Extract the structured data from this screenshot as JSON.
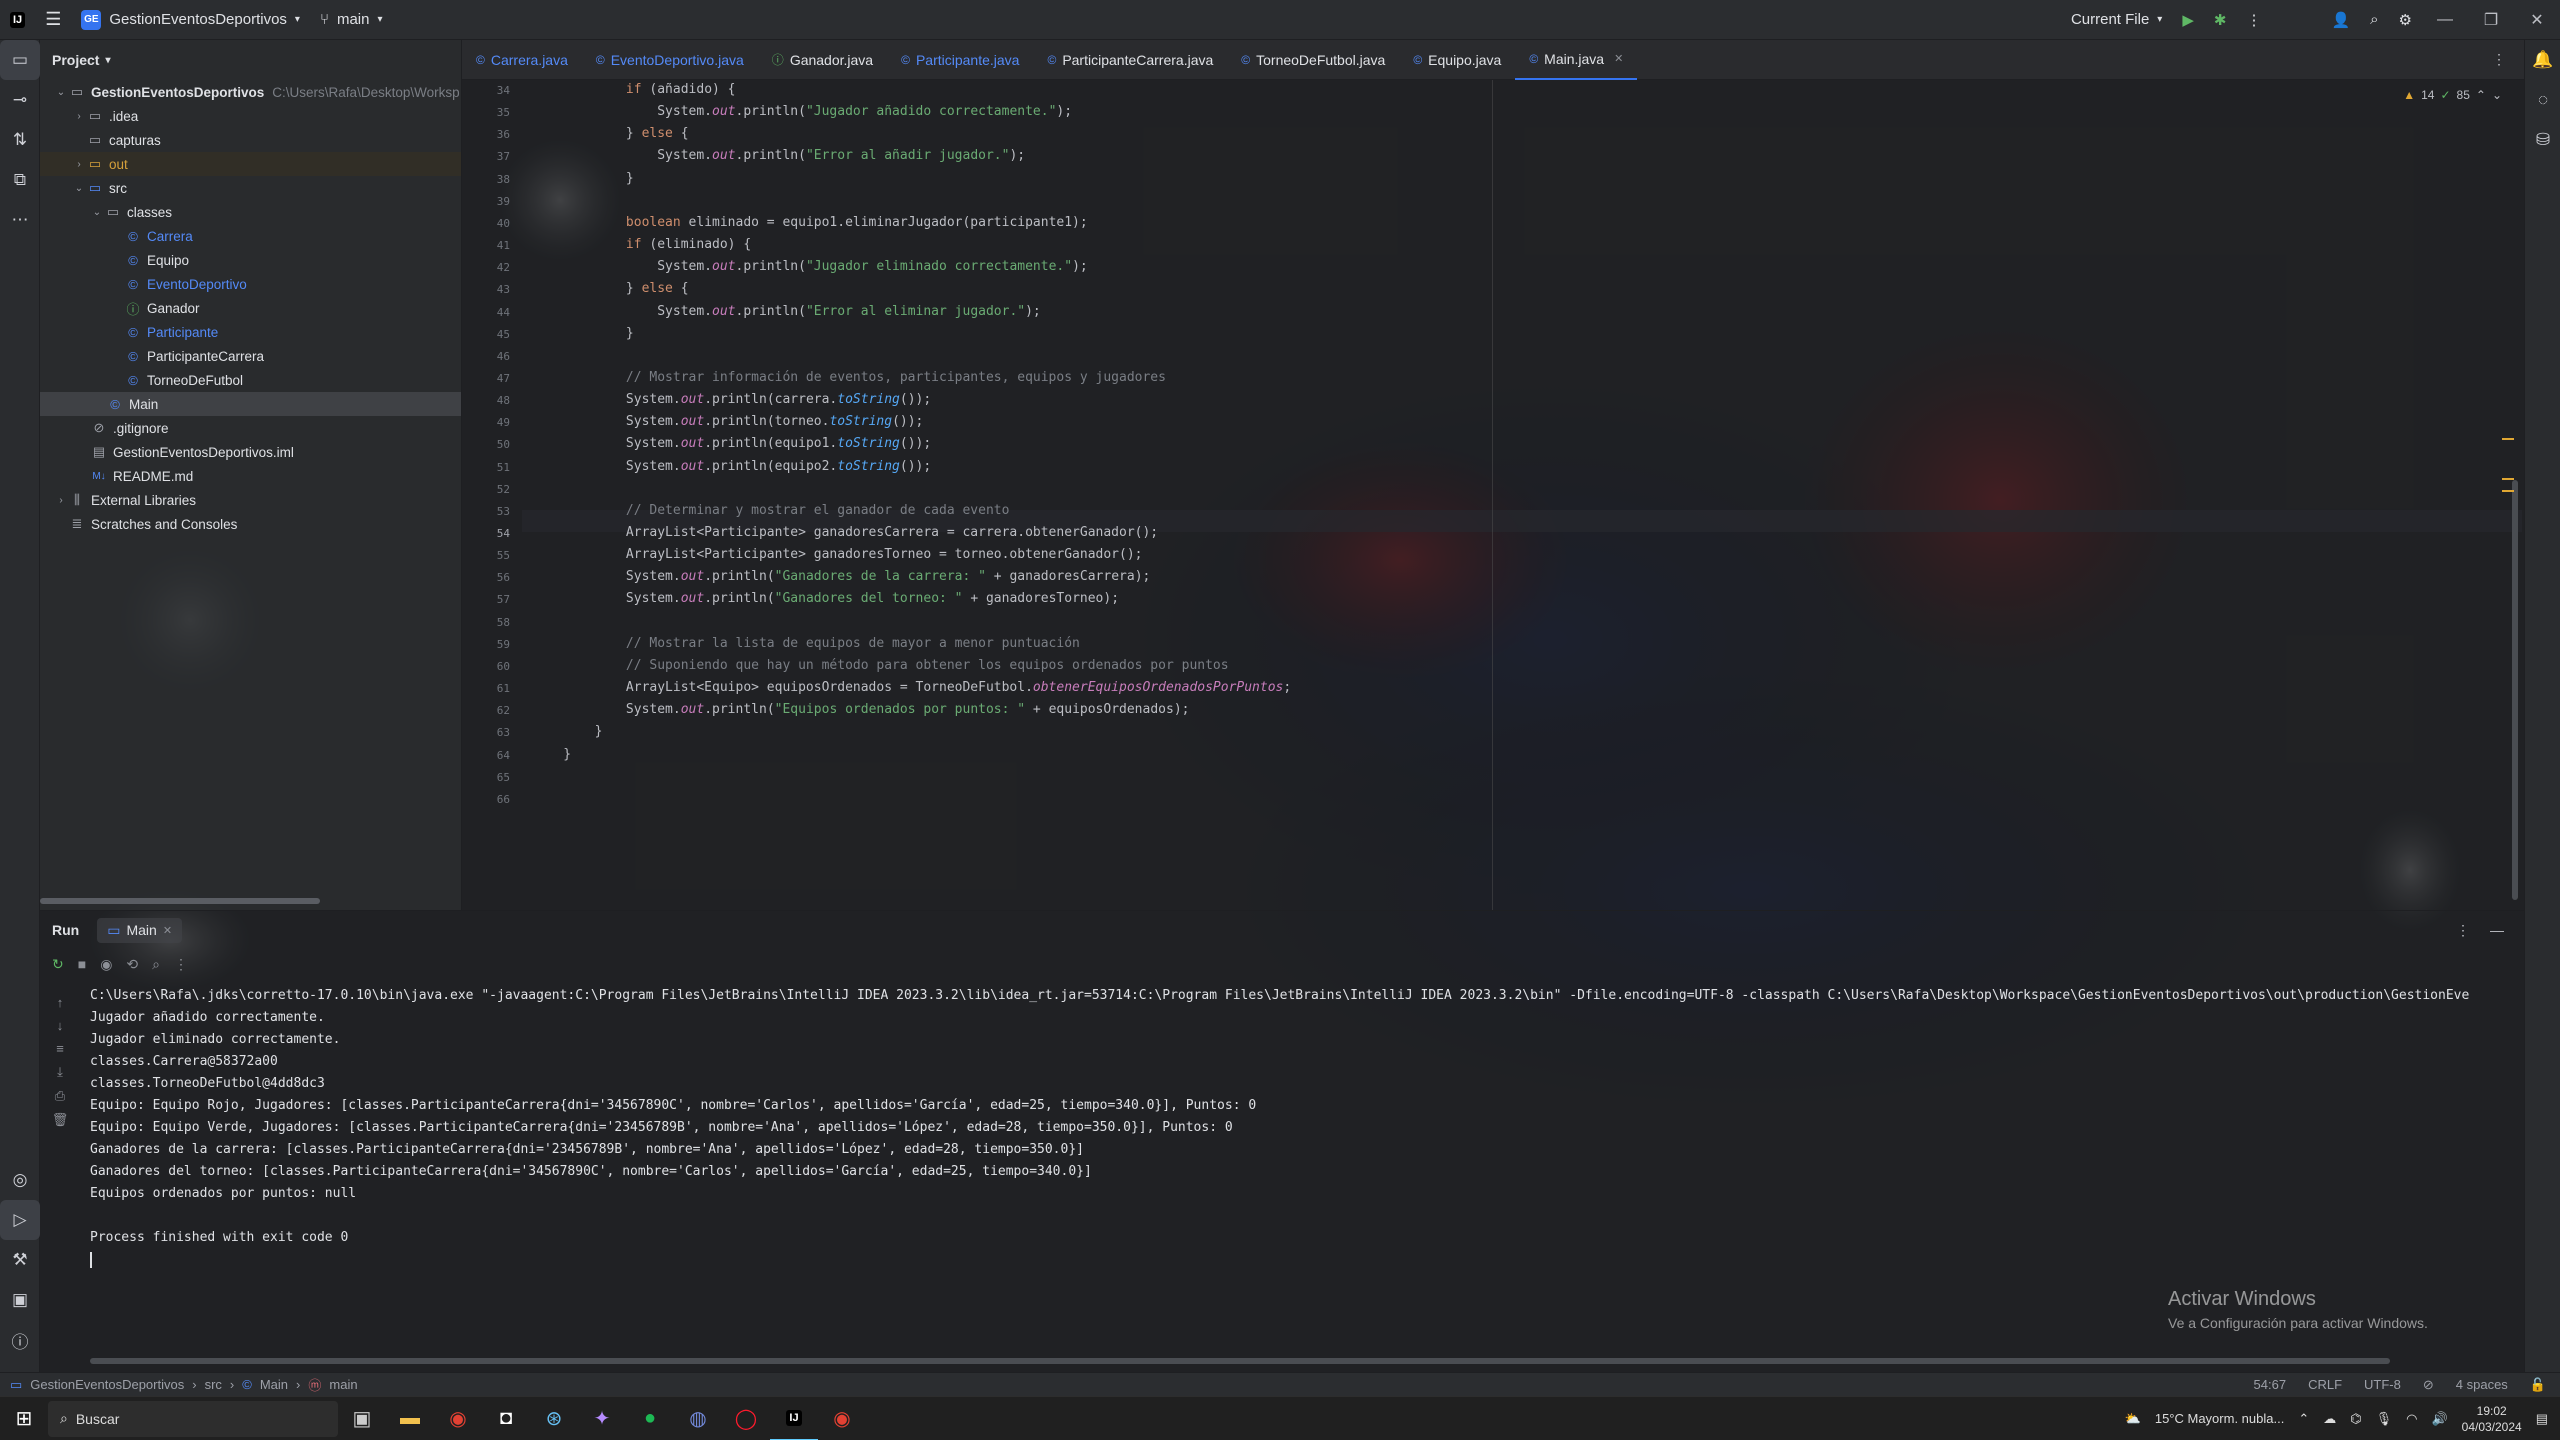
{
  "window": {
    "project_badge": "GE",
    "project_name": "GestionEventosDeportivos",
    "branch": "main",
    "run_config": "Current File"
  },
  "project_panel": {
    "title": "Project",
    "root_name": "GestionEventosDeportivos",
    "root_path": "C:\\Users\\Rafa\\Desktop\\Worksp",
    "items": [
      {
        "label": ".idea"
      },
      {
        "label": "capturas"
      },
      {
        "label": "out"
      },
      {
        "label": "src"
      },
      {
        "label": "classes"
      },
      {
        "label": "Carrera"
      },
      {
        "label": "Equipo"
      },
      {
        "label": "EventoDeportivo"
      },
      {
        "label": "Ganador"
      },
      {
        "label": "Participante"
      },
      {
        "label": "ParticipanteCarrera"
      },
      {
        "label": "TorneoDeFutbol"
      },
      {
        "label": "Main"
      },
      {
        "label": ".gitignore"
      },
      {
        "label": "GestionEventosDeportivos.iml"
      },
      {
        "label": "README.md"
      },
      {
        "label": "External Libraries"
      },
      {
        "label": "Scratches and Consoles"
      }
    ]
  },
  "tabs": [
    {
      "label": "Carrera.java"
    },
    {
      "label": "EventoDeportivo.java"
    },
    {
      "label": "Ganador.java"
    },
    {
      "label": "Participante.java"
    },
    {
      "label": "ParticipanteCarrera.java"
    },
    {
      "label": "TorneoDeFutbol.java"
    },
    {
      "label": "Equipo.java"
    },
    {
      "label": "Main.java"
    }
  ],
  "editor": {
    "warnings": "14",
    "checks": "85",
    "line_numbers": [
      "34",
      "35",
      "36",
      "37",
      "38",
      "39",
      "40",
      "41",
      "42",
      "43",
      "44",
      "45",
      "46",
      "47",
      "48",
      "49",
      "50",
      "51",
      "52",
      "53",
      "54",
      "55",
      "56",
      "57",
      "58",
      "59",
      "60",
      "61",
      "62",
      "63",
      "64",
      "65",
      "66"
    ],
    "lines": [
      "            if (añadido) {",
      "                System.out.println(\"Jugador añadido correctamente.\");",
      "            } else {",
      "                System.out.println(\"Error al añadir jugador.\");",
      "            }",
      "",
      "            boolean eliminado = equipo1.eliminarJugador(participante1);",
      "            if (eliminado) {",
      "                System.out.println(\"Jugador eliminado correctamente.\");",
      "            } else {",
      "                System.out.println(\"Error al eliminar jugador.\");",
      "            }",
      "",
      "            // Mostrar información de eventos, participantes, equipos y jugadores",
      "            System.out.println(carrera.toString());",
      "            System.out.println(torneo.toString());",
      "            System.out.println(equipo1.toString());",
      "            System.out.println(equipo2.toString());",
      "",
      "            // Determinar y mostrar el ganador de cada evento",
      "            ArrayList<Participante> ganadoresCarrera = carrera.obtenerGanador();",
      "            ArrayList<Participante> ganadoresTorneo = torneo.obtenerGanador();",
      "            System.out.println(\"Ganadores de la carrera: \" + ganadoresCarrera);",
      "            System.out.println(\"Ganadores del torneo: \" + ganadoresTorneo);",
      "",
      "            // Mostrar la lista de equipos de mayor a menor puntuación",
      "            // Suponiendo que hay un método para obtener los equipos ordenados por puntos",
      "            ArrayList<Equipo> equiposOrdenados = TorneoDeFutbol.obtenerEquiposOrdenadosPorPuntos;",
      "            System.out.println(\"Equipos ordenados por puntos: \" + equiposOrdenados);",
      "        }",
      "    }",
      "",
      ""
    ]
  },
  "run": {
    "title": "Run",
    "tab": "Main",
    "output": [
      "C:\\Users\\Rafa\\.jdks\\corretto-17.0.10\\bin\\java.exe \"-javaagent:C:\\Program Files\\JetBrains\\IntelliJ IDEA 2023.3.2\\lib\\idea_rt.jar=53714:C:\\Program Files\\JetBrains\\IntelliJ IDEA 2023.3.2\\bin\" -Dfile.encoding=UTF-8 -classpath C:\\Users\\Rafa\\Desktop\\Workspace\\GestionEventosDeportivos\\out\\production\\GestionEve",
      "Jugador añadido correctamente.",
      "Jugador eliminado correctamente.",
      "classes.Carrera@58372a00",
      "classes.TorneoDeFutbol@4dd8dc3",
      "Equipo: Equipo Rojo, Jugadores: [classes.ParticipanteCarrera{dni='34567890C', nombre='Carlos', apellidos='García', edad=25, tiempo=340.0}], Puntos: 0",
      "Equipo: Equipo Verde, Jugadores: [classes.ParticipanteCarrera{dni='23456789B', nombre='Ana', apellidos='López', edad=28, tiempo=350.0}], Puntos: 0",
      "Ganadores de la carrera: [classes.ParticipanteCarrera{dni='23456789B', nombre='Ana', apellidos='López', edad=28, tiempo=350.0}]",
      "Ganadores del torneo: [classes.ParticipanteCarrera{dni='34567890C', nombre='Carlos', apellidos='García', edad=25, tiempo=340.0}]",
      "Equipos ordenados por puntos: null",
      "",
      "Process finished with exit code 0"
    ]
  },
  "watermark": {
    "line1": "Activar Windows",
    "line2": "Ve a Configuración para activar Windows."
  },
  "statusbar": {
    "crumbs": [
      "GestionEventosDeportivos",
      "src",
      "Main",
      "main"
    ],
    "position": "54:67",
    "line_sep": "CRLF",
    "encoding": "UTF-8",
    "indent": "4 spaces"
  },
  "taskbar": {
    "search_placeholder": "Buscar",
    "weather": "15°C  Mayorm. nubla...",
    "time": "19:02",
    "date": "04/03/2024"
  },
  "colors": {
    "accent": "#3574f0",
    "string": "#6aab73",
    "keyword": "#cf8e6d",
    "method": "#56a8f5"
  }
}
